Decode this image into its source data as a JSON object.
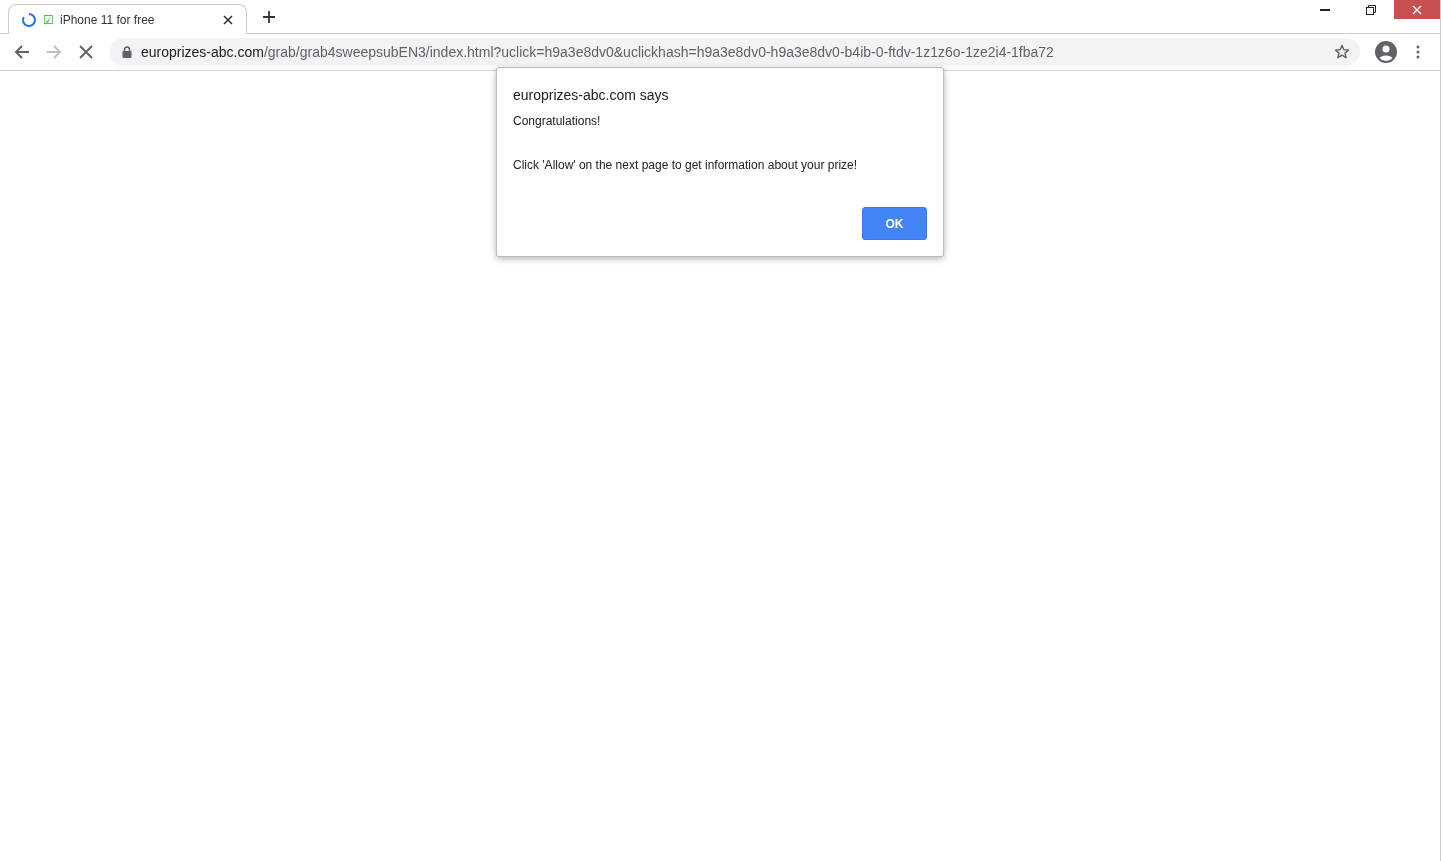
{
  "tab": {
    "title_mark": "☑",
    "title": "iPhone 11 for free",
    "loading": true,
    "selected": true
  },
  "address_bar": {
    "host": "europrizes-abc.com",
    "path": "/grab/grab4sweepsubEN3/index.html?uclick=h9a3e8dv0&uclickhash=h9a3e8dv0-h9a3e8dv0-b4ib-0-ftdv-1z1z6o-1ze2i4-1fba72"
  },
  "dialog": {
    "title": "europrizes-abc.com says",
    "message": [
      "Congratulations!",
      "Click 'Allow' on the next page to get information about your prize!"
    ],
    "button": "OK"
  }
}
